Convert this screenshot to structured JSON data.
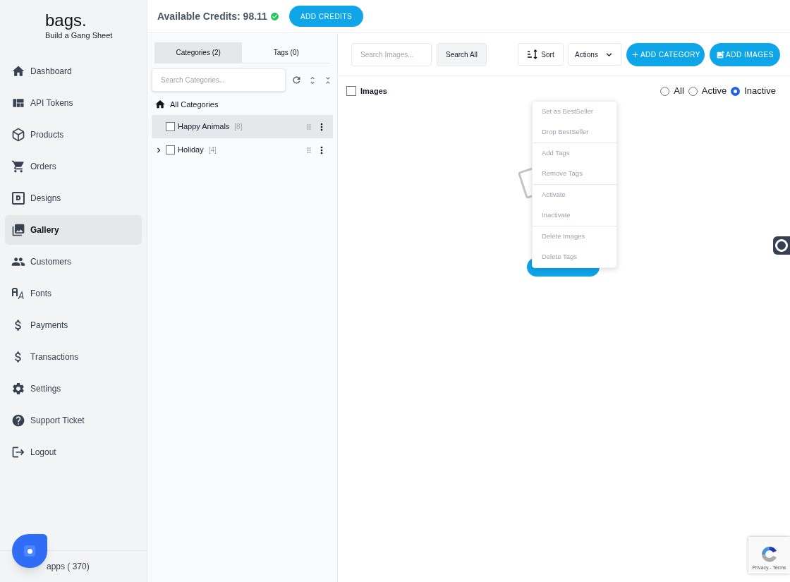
{
  "brand": {
    "name": "bags.",
    "tagline": "Build a Gang Sheet"
  },
  "sidebar": {
    "items": [
      {
        "kind": "home",
        "label": "Dashboard",
        "selected": false
      },
      {
        "kind": "token",
        "label": "API Tokens",
        "selected": false
      },
      {
        "kind": "box",
        "label": "Products",
        "selected": false
      },
      {
        "kind": "cart",
        "label": "Orders",
        "selected": false
      },
      {
        "kind": "design",
        "label": "Designs",
        "selected": false
      },
      {
        "kind": "gallery",
        "label": "Gallery",
        "selected": true
      },
      {
        "kind": "people",
        "label": "Customers",
        "selected": false
      },
      {
        "kind": "font",
        "label": "Fonts",
        "selected": false
      },
      {
        "kind": "dollar",
        "label": "Payments",
        "selected": false
      },
      {
        "kind": "dollar",
        "label": "Transactions",
        "selected": false
      },
      {
        "kind": "gear",
        "label": "Settings",
        "selected": false
      },
      {
        "kind": "help",
        "label": "Support Ticket",
        "selected": false
      },
      {
        "kind": "logout",
        "label": "Logout",
        "selected": false
      }
    ],
    "footer": "apps ( 370)"
  },
  "header": {
    "credits_label": "Available Credits: 98.11",
    "add_credits": "ADD CREDITS"
  },
  "categories_panel": {
    "tabs": [
      {
        "label": "Categories (2)",
        "selected": true
      },
      {
        "label": "Tags (0)",
        "selected": false
      }
    ],
    "search_placeholder": "Search Categories...",
    "all_label": "All Categories",
    "items": [
      {
        "name": "Happy Animals",
        "count": "[8]",
        "selected": true,
        "checked": false,
        "expandable": false
      },
      {
        "name": "Holiday",
        "count": "[4]",
        "selected": false,
        "checked": false,
        "expandable": true
      }
    ]
  },
  "toolbar": {
    "search_placeholder": "Search Images...",
    "search_all": "Search All",
    "sort": "Sort",
    "actions": "Actions",
    "add_category": "ADD CATEGORY",
    "add_images": "ADD IMAGES"
  },
  "images_header": {
    "label": "Images",
    "checked": false,
    "filters": [
      {
        "label": "All",
        "selected": false
      },
      {
        "label": "Active",
        "selected": false
      },
      {
        "label": "Inactive",
        "selected": true
      }
    ]
  },
  "actions_menu": [
    [
      "Set as BestSeller",
      "Drop BestSeller"
    ],
    [
      "Add Tags",
      "Remove Tags"
    ],
    [
      "Activate",
      "Inactivate"
    ],
    [
      "Delete Images",
      "Delete Tags"
    ]
  ],
  "recaptcha": {
    "text": "Privacy - Terms"
  }
}
